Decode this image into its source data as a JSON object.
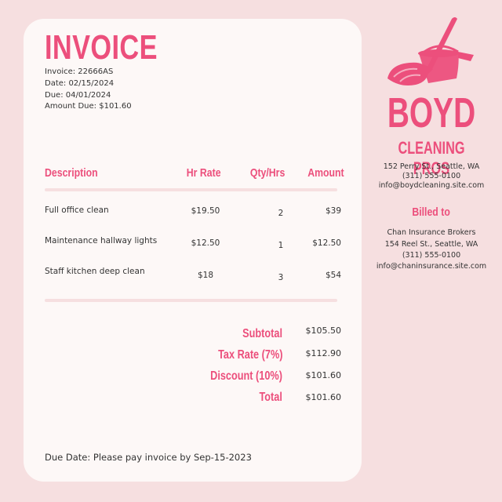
{
  "invoice": {
    "title": "INVOICE",
    "number": "Invoice: 22666AS",
    "date": "Date: 02/15/2024",
    "due": "Due: 04/01/2024",
    "amount_due": "Amount Due: $101.60"
  },
  "table": {
    "headers": [
      "Description",
      "Hr Rate",
      "Qty/Hrs",
      "Amount"
    ],
    "rows": [
      {
        "description": "Full office clean",
        "rate": "$19.50",
        "qty": "2",
        "amount": "$39"
      },
      {
        "description": "Maintenance hallway lights",
        "rate": "$12.50",
        "qty": "1",
        "amount": "$12.50"
      },
      {
        "description": "Staff kitchen deep clean",
        "rate": "$18",
        "qty": "3",
        "amount": "$54"
      }
    ]
  },
  "totals": [
    {
      "label": "Subtotal",
      "value": "$105.50"
    },
    {
      "label": "Tax Rate (7%)",
      "value": "$112.90"
    },
    {
      "label": "Discount (10%)",
      "value": "$101.60"
    },
    {
      "label": "Total",
      "value": "$101.60"
    }
  ],
  "footer": "Due Date: Please pay invoice by Sep-15-2023",
  "company": {
    "name_line1": "BOYD",
    "name_line2": "CLEANING PROS",
    "address": "152 Perry St., Seattle, WA",
    "phone": "(311) 555-0100",
    "email": "info@boydcleaning.site.com",
    "logo_icon": "bucket-mop-icon"
  },
  "billed_to": {
    "heading": "Billed to",
    "name": "Chan Insurance Brokers",
    "address": "154 Reel St., Seattle, WA",
    "phone": "(311) 555-0100",
    "email": "info@chaninsurance.site.com"
  },
  "colors": {
    "accent": "#ec4f7c",
    "background": "#f6dfe0",
    "card": "#fdf8f7"
  }
}
